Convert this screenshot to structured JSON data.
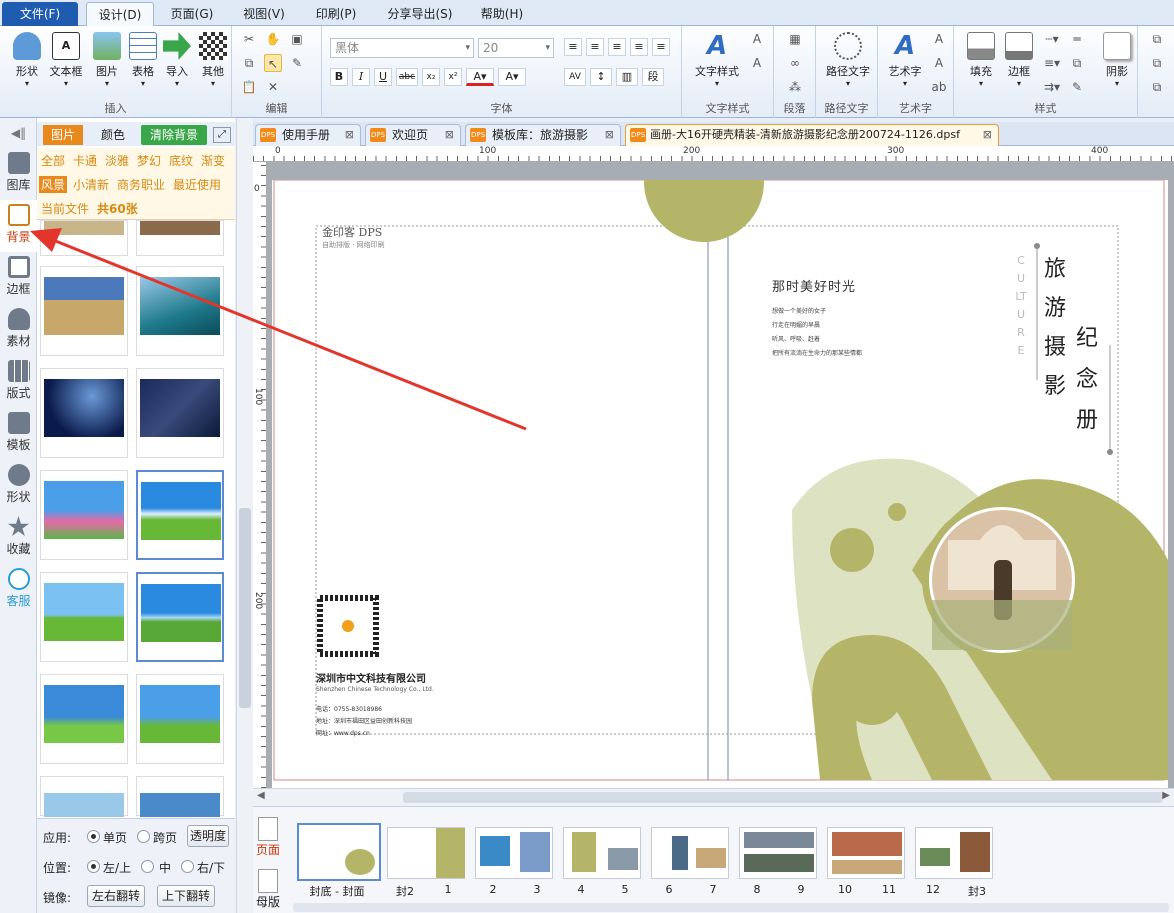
{
  "menu": {
    "items": [
      "文件(F)",
      "设计(D)",
      "页面(G)",
      "视图(V)",
      "印刷(P)",
      "分享导出(S)",
      "帮助(H)"
    ]
  },
  "ribbon": {
    "insert": {
      "label": "插入",
      "buttons": [
        "形状",
        "文本框",
        "图片",
        "表格",
        "导入",
        "其他"
      ]
    },
    "edit": {
      "label": "编辑"
    },
    "font": {
      "label": "字体",
      "family_placeholder": "黑体",
      "size_placeholder": "20"
    },
    "text_style": {
      "label": "文字样式",
      "button": "文字样式"
    },
    "paragraph": {
      "label": "段落"
    },
    "path_text": {
      "label": "路径文字",
      "button": "路径文字"
    },
    "art_text": {
      "label": "艺术字",
      "button": "艺术字"
    },
    "style": {
      "label": "样式",
      "buttons": [
        "填充",
        "边框",
        "阴影"
      ]
    }
  },
  "leftbar": {
    "items": [
      "图库",
      "背景",
      "边框",
      "素材",
      "版式",
      "模板",
      "形状",
      "收藏",
      "客服"
    ]
  },
  "panel": {
    "tabs": [
      "图片",
      "颜色"
    ],
    "clear_bg": "清除背景",
    "filters": [
      "全部",
      "卡通",
      "淡雅",
      "梦幻",
      "底纹",
      "渐变",
      "风景",
      "小清新",
      "商务职业",
      "最近使用"
    ],
    "current_file": "当前文件",
    "count": "共60张",
    "apply_label": "应用:",
    "apply_options": [
      "单页",
      "跨页"
    ],
    "transparency": "透明度",
    "position_label": "位置:",
    "position_options": [
      "左/上",
      "中",
      "右/下"
    ],
    "mirror_label": "镜像:",
    "mirror_buttons": [
      "左右翻转",
      "上下翻转"
    ]
  },
  "doctabs": [
    "使用手册",
    "欢迎页",
    "模板库：旅游摄影",
    "画册-大16开硬壳精装-清新旅游摄影纪念册200724-1126.dpsf"
  ],
  "ruler": {
    "h": [
      "0",
      "100",
      "200",
      "300",
      "400"
    ],
    "v": [
      "0",
      "100",
      "200"
    ]
  },
  "page": {
    "logo": "金印客 DPS",
    "logo_sub": "自助排版 · 网络印刷",
    "heading": "那时美好时光",
    "lines": [
      "想做一个美好的女子",
      "行走在明媚的早晨",
      "听风、呼吸、赶着",
      "把所有流淌在生命力的那某些情都"
    ],
    "vertical_en": "CULTURE",
    "title_col1": "旅游摄影",
    "title_col2": "纪念册",
    "company": "深圳市中文科技有限公司",
    "company_en": "Shenzhen Chinese Technology Co., Ltd.",
    "phone": "电话：0755-83018986",
    "address": "地址：深圳市福田区益田创新科技园",
    "website": "网址：www.dps.cn"
  },
  "strip": {
    "page_tab": "页面",
    "master_tab": "母版",
    "labels": [
      "封底 - 封面",
      "封2",
      "1",
      "2",
      "3",
      "4",
      "5",
      "6",
      "7",
      "8",
      "9",
      "10",
      "11",
      "12",
      "封3"
    ]
  },
  "colors": {
    "accent_green": "#b5b569",
    "light_green": "#dde3c2",
    "file_menu": "#1e5bb1",
    "arrow": "#e2352b",
    "orange": "#d78a11"
  }
}
